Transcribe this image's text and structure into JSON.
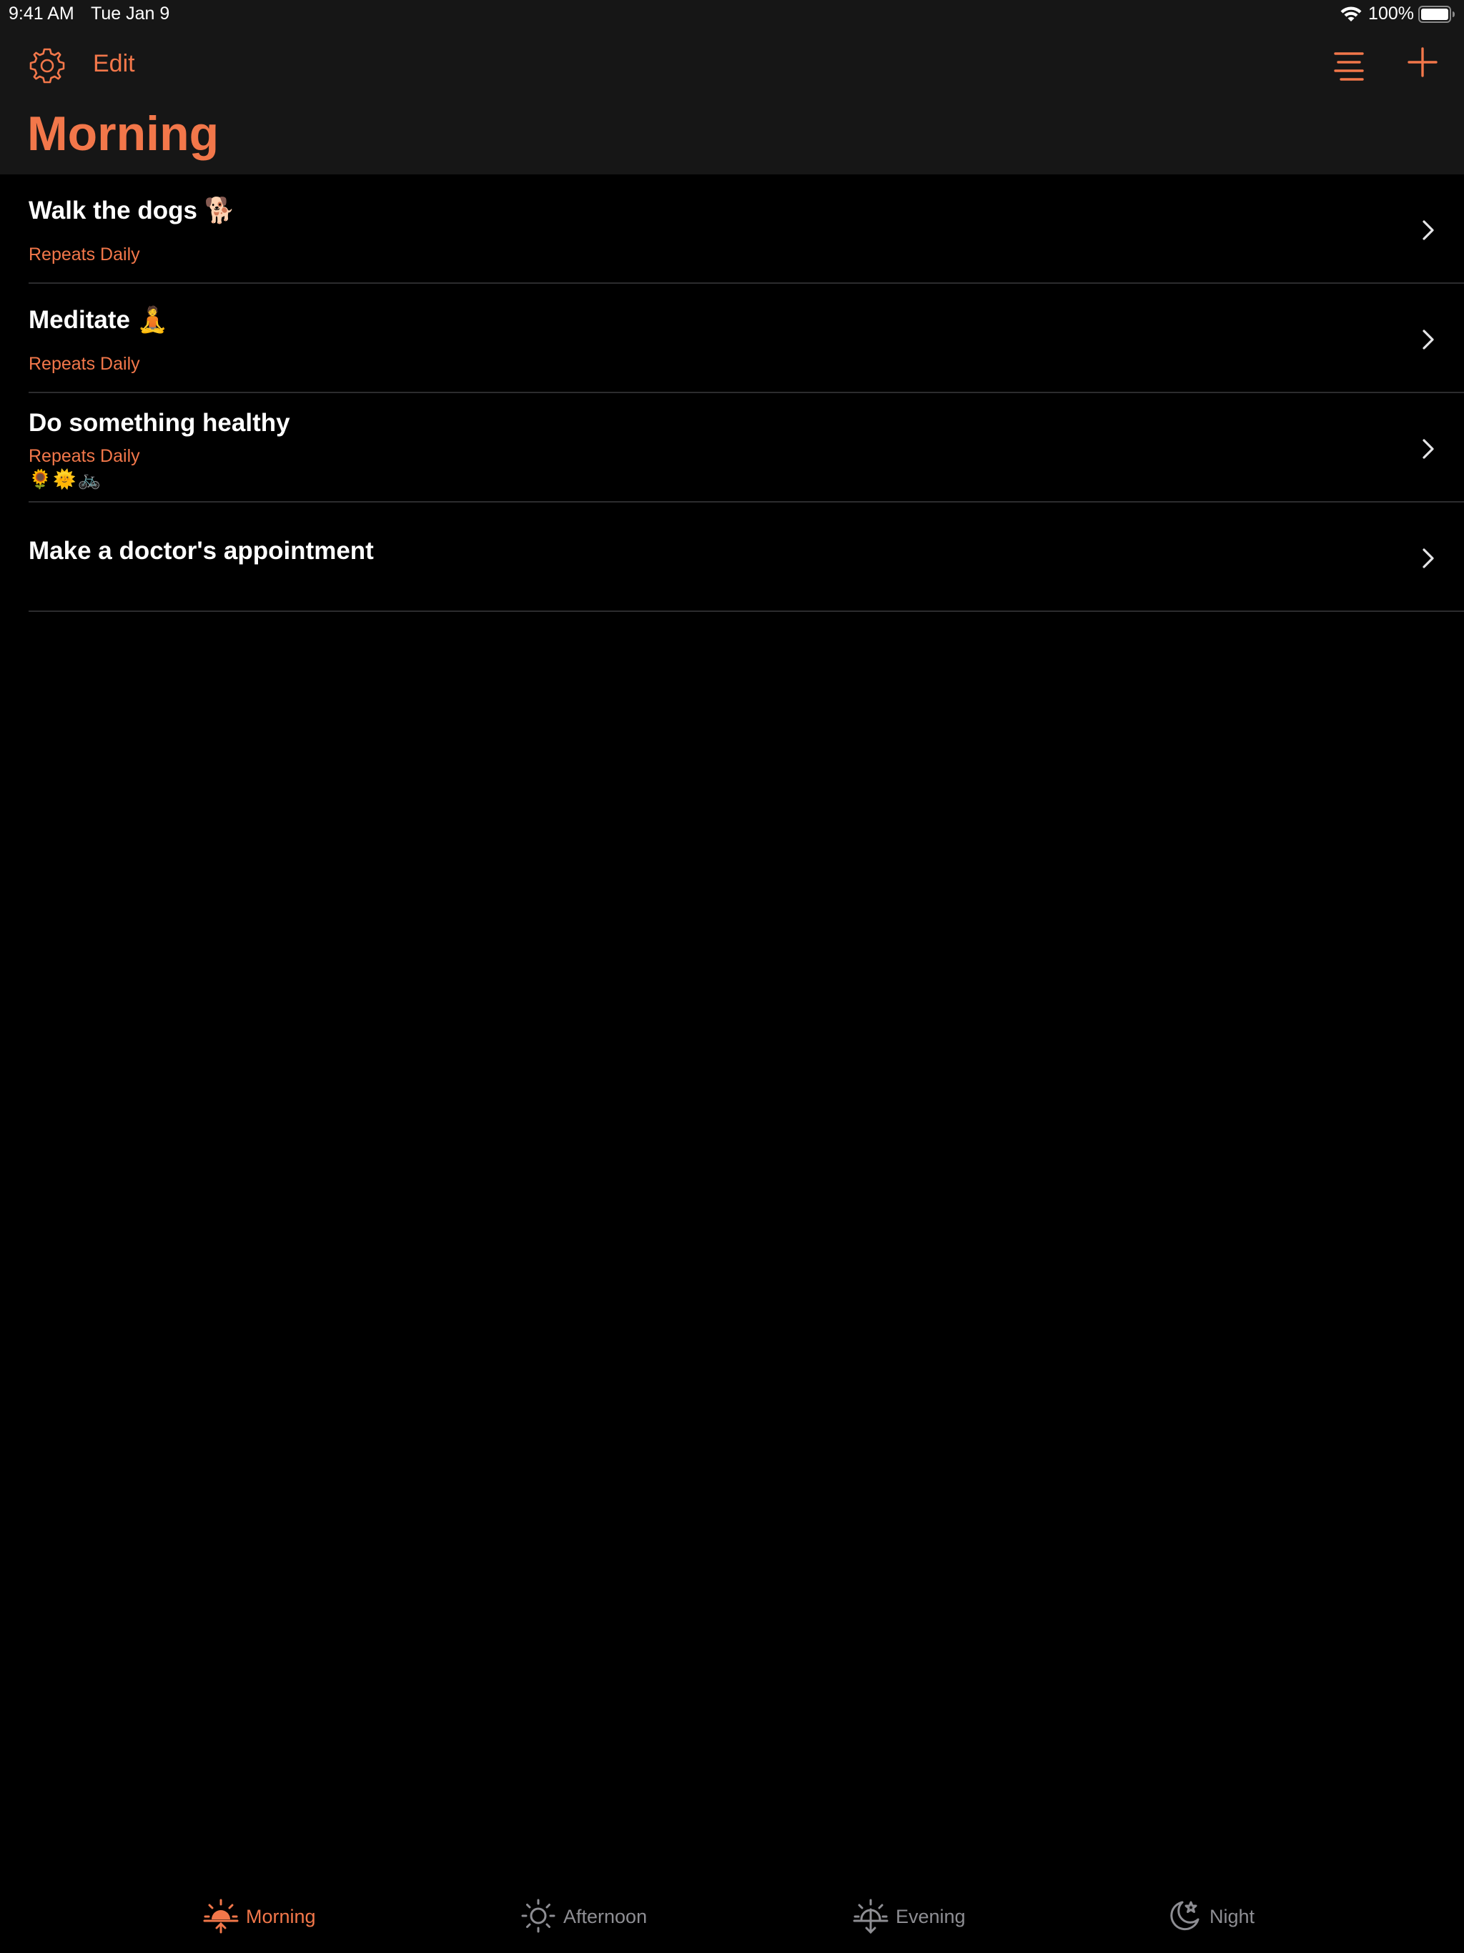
{
  "status_bar": {
    "time": "9:41 AM",
    "date": "Tue Jan 9",
    "battery": "100%"
  },
  "nav": {
    "edit_label": "Edit",
    "title": "Morning"
  },
  "tasks": [
    {
      "title": "Walk the dogs 🐕",
      "subtitle": "Repeats Daily",
      "tags": ""
    },
    {
      "title": "Meditate 🧘",
      "subtitle": "Repeats Daily",
      "tags": ""
    },
    {
      "title": "Do something healthy",
      "subtitle": "Repeats Daily",
      "tags": "🌻🌞🚲"
    },
    {
      "title": "Make a doctor's appointment",
      "subtitle": "",
      "tags": ""
    }
  ],
  "tabs": [
    {
      "label": "Morning",
      "icon": "sunrise-icon",
      "selected": true
    },
    {
      "label": "Afternoon",
      "icon": "sun-icon",
      "selected": false
    },
    {
      "label": "Evening",
      "icon": "sunset-icon",
      "selected": false
    },
    {
      "label": "Night",
      "icon": "moon-icon",
      "selected": false
    }
  ],
  "colors": {
    "accent": "#f2774a",
    "background": "#000000",
    "bar_background": "#161616",
    "separator": "#2c2c2e",
    "inactive": "#8e8e93"
  }
}
